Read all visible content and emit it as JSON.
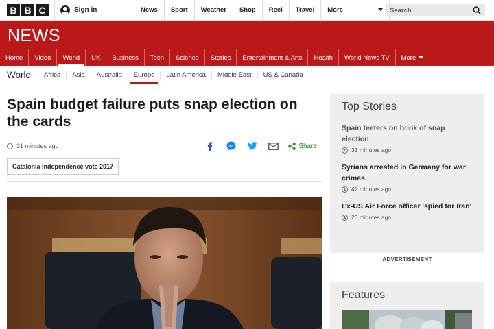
{
  "brand": {
    "logo_letters": [
      "B",
      "B",
      "C"
    ],
    "section_logo": "NEWS",
    "accent_color": "#bb1919"
  },
  "topbar": {
    "signin_label": "Sign in",
    "nav": [
      "News",
      "Sport",
      "Weather",
      "Shop",
      "Reel",
      "Travel"
    ],
    "more_label": "More",
    "search_placeholder": "Search"
  },
  "main_nav": {
    "items": [
      "Home",
      "Video",
      "World",
      "UK",
      "Business",
      "Tech",
      "Science",
      "Stories",
      "Entertainment & Arts",
      "Health",
      "World News TV"
    ],
    "more_label": "More",
    "active": "World"
  },
  "sub_nav": {
    "section": "World",
    "items": [
      "Africa",
      "Asia",
      "Australia",
      "Europe",
      "Latin America",
      "Middle East",
      "US & Canada"
    ],
    "active": "Europe"
  },
  "article": {
    "headline": "Spain budget failure puts snap election on the cards",
    "timestamp": "31 minutes ago",
    "share_label": "Share",
    "share_icons": [
      "facebook-icon",
      "messenger-icon",
      "twitter-icon",
      "email-icon",
      "share-icon"
    ],
    "tag": "Catalonia independence vote 2017"
  },
  "sidebar": {
    "top_stories_title": "Top Stories",
    "stories": [
      {
        "title": "Spain teeters on brink of snap election",
        "time": "31 minutes ago"
      },
      {
        "title": "Syrians arrested in Germany for war crimes",
        "time": "42 minutes ago"
      },
      {
        "title": "Ex-US Air Force officer 'spied for Iran'",
        "time": "26 minutes ago"
      }
    ],
    "advertisement_label": "ADVERTISEMENT",
    "features_title": "Features"
  }
}
